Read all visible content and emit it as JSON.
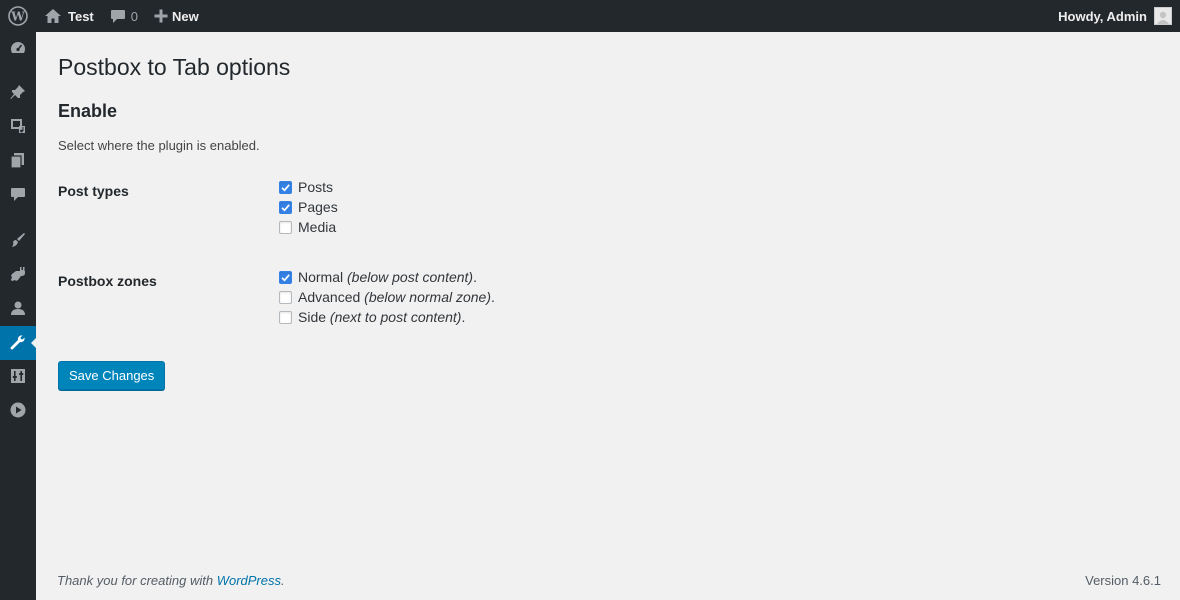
{
  "adminbar": {
    "site_name": "Test",
    "comments_count": "0",
    "new_label": "New",
    "greeting": "Howdy, Admin"
  },
  "sidebar": {
    "items": [
      {
        "icon": "dashboard-icon"
      },
      {
        "icon": "pin-icon"
      },
      {
        "icon": "media-icon"
      },
      {
        "icon": "pages-icon"
      },
      {
        "icon": "comments-icon"
      },
      {
        "icon": "appearance-icon"
      },
      {
        "icon": "plugins-icon"
      },
      {
        "icon": "users-icon"
      },
      {
        "icon": "tools-icon",
        "active": true
      },
      {
        "icon": "settings-icon"
      },
      {
        "icon": "play-icon"
      }
    ]
  },
  "page": {
    "title": "Postbox to Tab options",
    "section_title": "Enable",
    "section_desc": "Select where the plugin is enabled.",
    "post_types_label": "Post types",
    "post_types": [
      {
        "label": "Posts",
        "checked": true
      },
      {
        "label": "Pages",
        "checked": true
      },
      {
        "label": "Media",
        "checked": false
      }
    ],
    "zones_label": "Postbox zones",
    "zones": [
      {
        "label": "Normal",
        "note": "(below post content)",
        "checked": true
      },
      {
        "label": "Advanced",
        "note": "(below normal zone)",
        "checked": false
      },
      {
        "label": "Side",
        "note": "(next to post content)",
        "checked": false
      }
    ],
    "save_label": "Save Changes"
  },
  "footer": {
    "thanks_prefix": "Thank you for creating with ",
    "link_text": "WordPress",
    "suffix": ".",
    "version": "Version 4.6.1"
  },
  "colors": {
    "adminbar_bg": "#23282d",
    "active_menu": "#0073aa",
    "button": "#0085ba",
    "checkbox_checked": "#3582e6"
  }
}
